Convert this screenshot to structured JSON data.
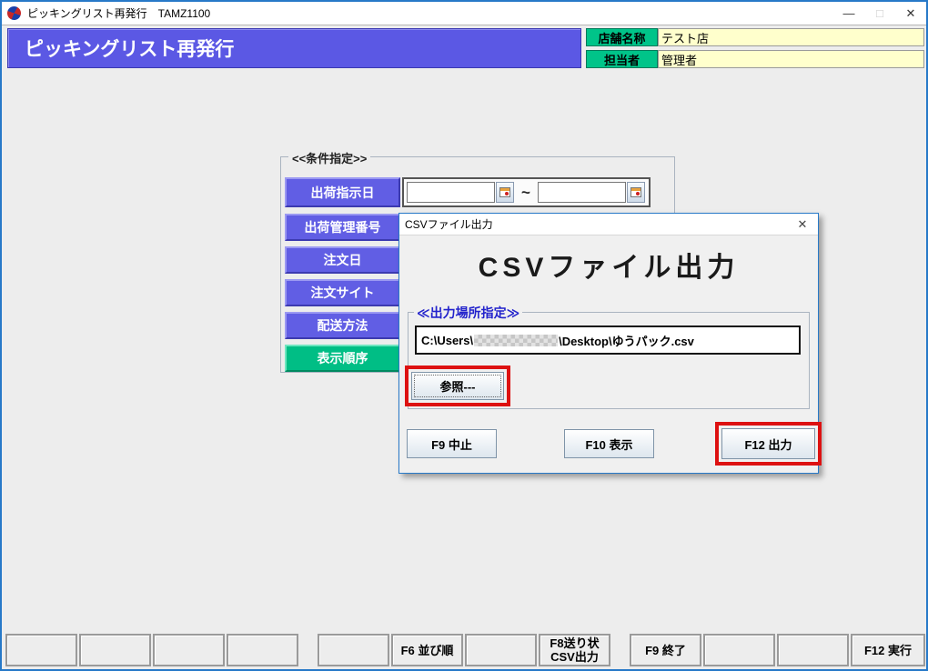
{
  "window": {
    "title": "ピッキングリスト再発行　TAMZ1100",
    "minimize": "—",
    "maximize": "□",
    "close": "✕"
  },
  "header": {
    "title": "ピッキングリスト再発行",
    "store_label": "店舗名称",
    "store_value": "テスト店",
    "manager_label": "担当者",
    "manager_value": "管理者"
  },
  "condition": {
    "legend": "<<条件指定>>",
    "ship_date_label": "出荷指示日",
    "date_from": "",
    "date_to": "",
    "range_separator": "~",
    "row_labels": [
      "出荷管理番号",
      "注文日",
      "注文サイト",
      "配送方法",
      "表示順序"
    ]
  },
  "dialog": {
    "titlebar_text": "CSVファイル出力",
    "close": "✕",
    "heading": "CSVファイル出力",
    "output_legend": "≪出力場所指定≫",
    "path_prefix": "C:\\Users\\",
    "path_suffix": "\\Desktop\\ゆうパック.csv",
    "browse_label": "参照---",
    "cancel_label": "F9 中止",
    "show_label": "F10 表示",
    "output_label": "F12 出力"
  },
  "function_bar": {
    "keys": [
      "",
      "",
      "",
      "",
      "",
      "F6 並び順",
      "",
      "F8送り状\nCSV出力",
      "F9 終了",
      "",
      "",
      "F12 実行"
    ]
  },
  "colors": {
    "accent_blue": "#5b58e4",
    "label_green": "#00c489",
    "field_yellow": "#ffffcc",
    "highlight_red": "#dd1111",
    "window_border": "#2779c8"
  }
}
